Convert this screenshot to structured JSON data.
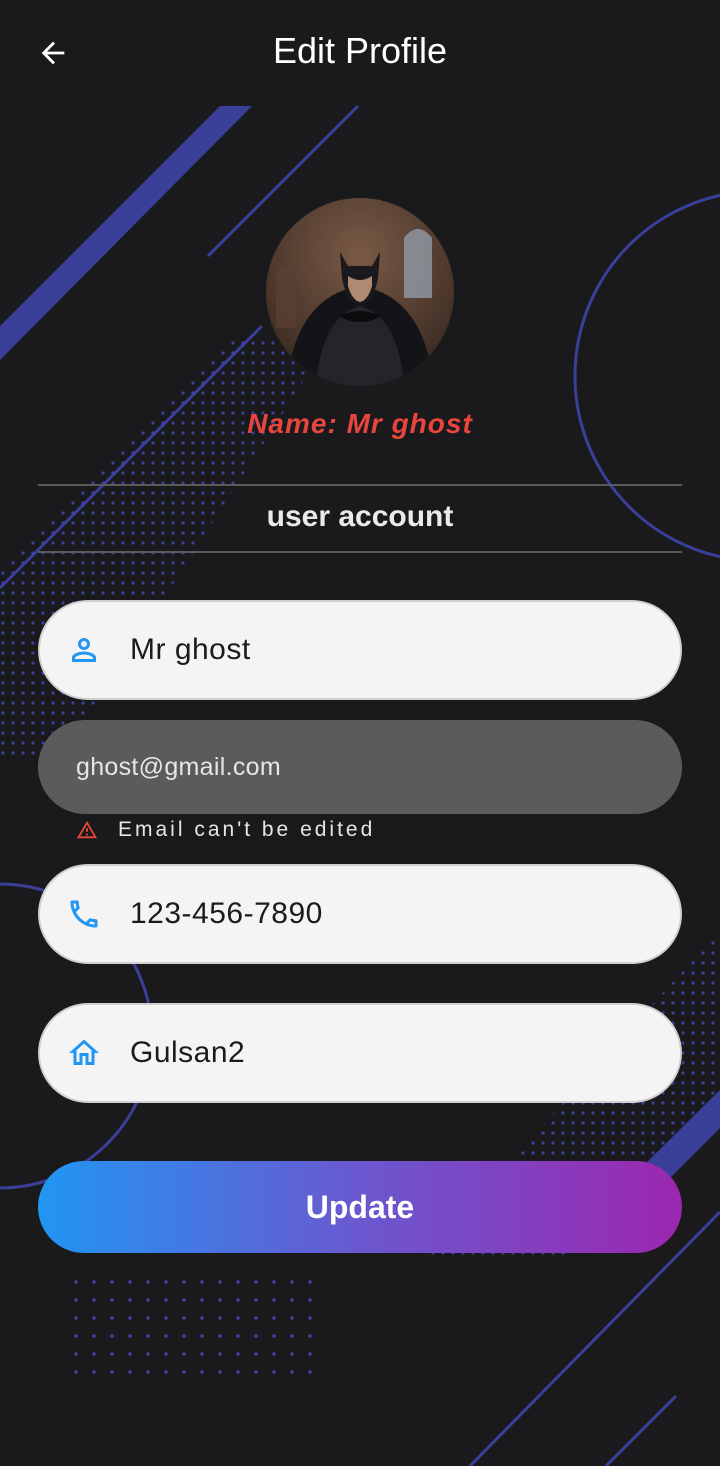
{
  "appbar": {
    "title": "Edit Profile",
    "back_icon": "arrow-back-icon"
  },
  "profile": {
    "name_label": "Name:",
    "name_value": "Mr ghost",
    "avatar_icon": "profile-avatar"
  },
  "section": {
    "title": "user account"
  },
  "form": {
    "name": {
      "value": "Mr ghost",
      "icon": "person-icon"
    },
    "email": {
      "value": "ghost@gmail.com",
      "hint": "Email can't be edited",
      "hint_icon": "warning-icon"
    },
    "phone": {
      "value": "123-456-7890",
      "icon": "phone-icon"
    },
    "address": {
      "value": "Gulsan2",
      "icon": "home-icon"
    }
  },
  "actions": {
    "update_label": "Update"
  },
  "colors": {
    "background": "#1a1a1c",
    "accent_blue": "#2196f3",
    "accent_purple": "#9c27b0",
    "name_red": "#e8453c",
    "decor_indigo": "#3a3f9a"
  }
}
